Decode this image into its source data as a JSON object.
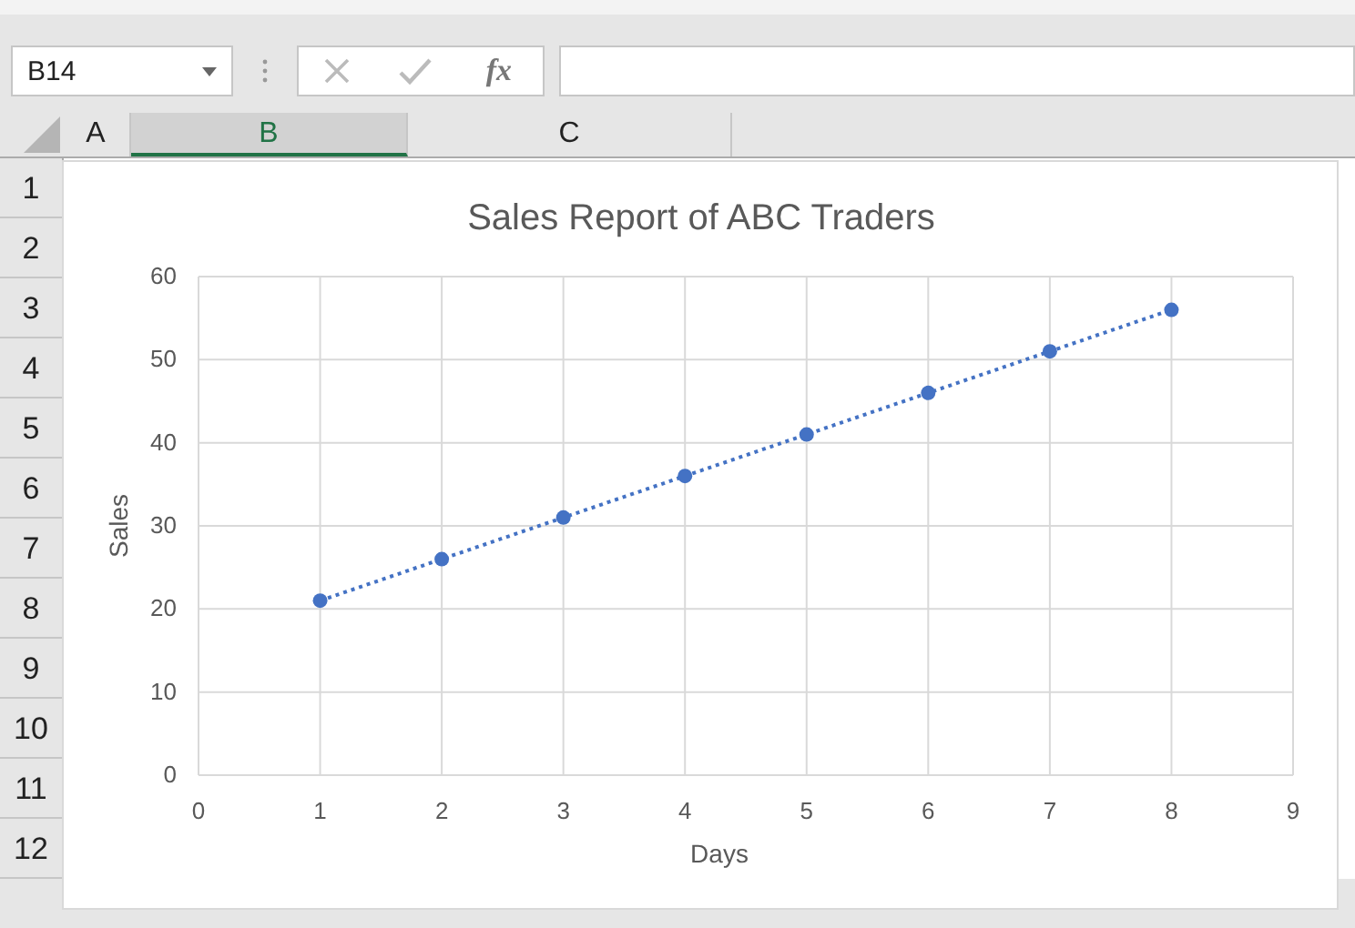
{
  "name_box": {
    "value": "B14"
  },
  "formula_bar": {
    "function_button": "fx"
  },
  "columns": [
    {
      "label": "A",
      "selected": false
    },
    {
      "label": "B",
      "selected": true
    },
    {
      "label": "C",
      "selected": false
    }
  ],
  "rows": [
    "1",
    "2",
    "3",
    "4",
    "5",
    "6",
    "7",
    "8",
    "9",
    "10",
    "11",
    "12"
  ],
  "chart": {
    "chart_data": {
      "type": "line",
      "title": "Sales Report of ABC Traders",
      "xlabel": "Days",
      "ylabel": "Sales",
      "x": [
        1,
        2,
        3,
        4,
        5,
        6,
        7,
        8
      ],
      "series": [
        {
          "color": "#4472c4",
          "line_style": "dotted",
          "marker": "circle",
          "values": [
            21,
            26,
            31,
            36,
            41,
            46,
            51,
            56
          ]
        }
      ],
      "xlim": [
        0,
        9
      ],
      "ylim": [
        0,
        60
      ],
      "xticks": [
        0,
        1,
        2,
        3,
        4,
        5,
        6,
        7,
        8,
        9
      ],
      "yticks": [
        0,
        10,
        20,
        30,
        40,
        50,
        60
      ],
      "grid": true
    }
  }
}
